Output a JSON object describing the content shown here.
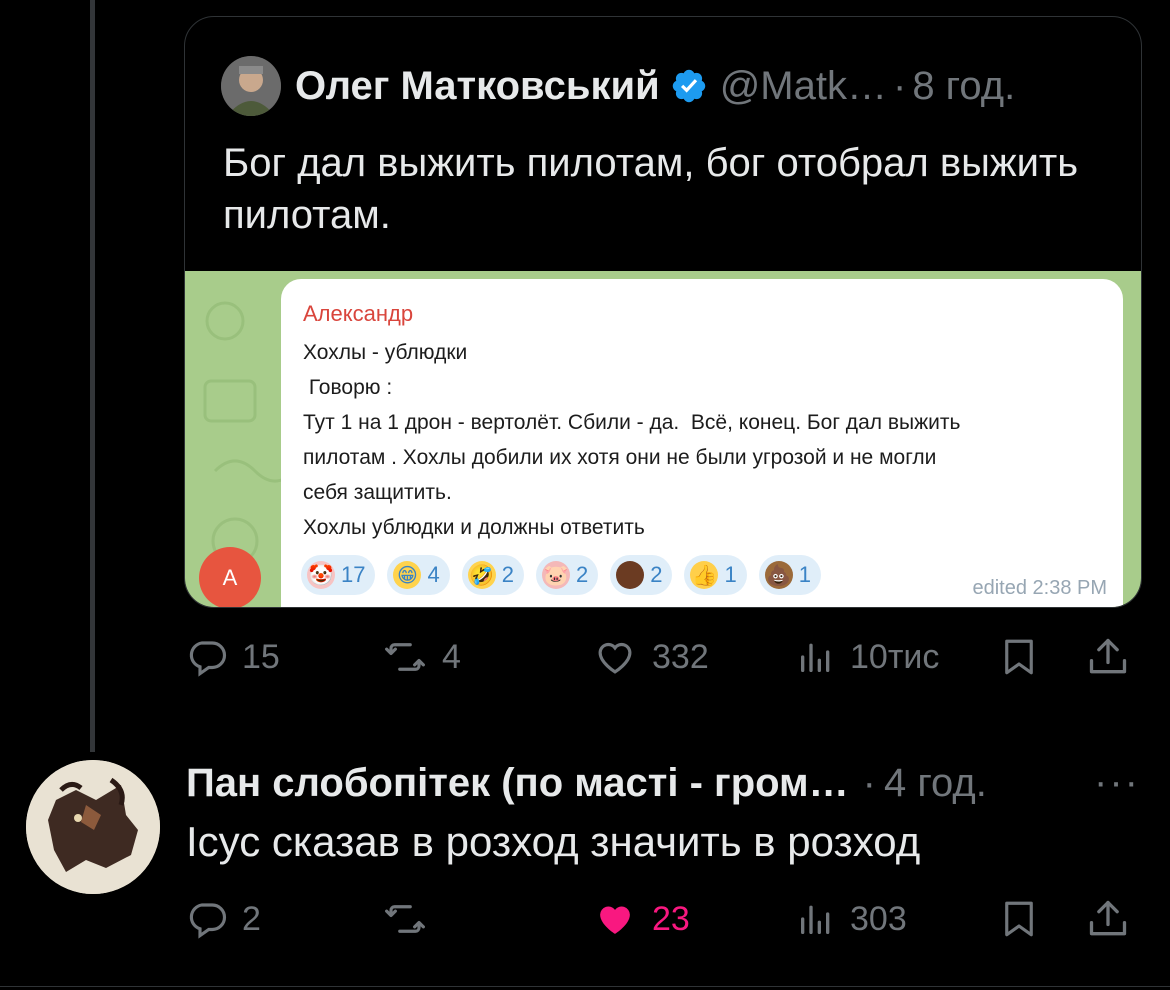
{
  "quoted_tweet": {
    "author_name": "Олег Матковський",
    "handle": "@Matk…",
    "separator": "·",
    "time": "8 год.",
    "text": "Бог дал выжить пилотам, бог отобрал выжить пилотам.",
    "image": {
      "sender": "Александр",
      "lines": [
        "Хохлы - ублюдки",
        " Говорю :",
        "Тут 1 на 1 дрон - вертолёт. Сбили - да.  Всё, конец. Бог дал выжить",
        "пилотам . Хохлы добили их хотя они не были угрозой и не могли",
        "себя защитить.",
        "Хохлы ублюдки и должны ответить"
      ],
      "reactions": [
        {
          "icon": "clown-emoji-icon",
          "glyph": "🤡",
          "count": "17",
          "bg": "#f7c3c3"
        },
        {
          "icon": "grin-emoji-icon",
          "glyph": "😁",
          "count": "4",
          "bg": "#ffd34d"
        },
        {
          "icon": "rofl-emoji-icon",
          "glyph": "🤣",
          "count": "2",
          "bg": "#ffd34d"
        },
        {
          "icon": "pig-soldier-emoji-icon",
          "glyph": "🐷",
          "count": "2",
          "bg": "#f4b8b8"
        },
        {
          "icon": "photo-sticker-icon",
          "glyph": "",
          "count": "2",
          "bg": "#6b3b22"
        },
        {
          "icon": "thumbs-up-emoji-icon",
          "glyph": "👍",
          "count": "1",
          "bg": "#ffcf4a"
        },
        {
          "icon": "poop-emoji-icon",
          "glyph": "💩",
          "count": "1",
          "bg": "#9b6a3a"
        }
      ],
      "edited": "edited 2:38 PM",
      "avatar_letter": "A"
    },
    "stats": {
      "replies": "15",
      "reposts": "4",
      "likes": "332",
      "views": "10тис"
    }
  },
  "reply": {
    "author_name": "Пан слобопітек (по масті - гром…",
    "separator": "·",
    "time": "4 год.",
    "more": "···",
    "text": "Ісус сказав в розход значить в розход",
    "stats": {
      "replies": "2",
      "reposts": "",
      "likes": "23",
      "views": "303"
    }
  },
  "colors": {
    "accent_like": "#f91880",
    "verified": "#1d9bf0",
    "muted": "#71767b"
  }
}
